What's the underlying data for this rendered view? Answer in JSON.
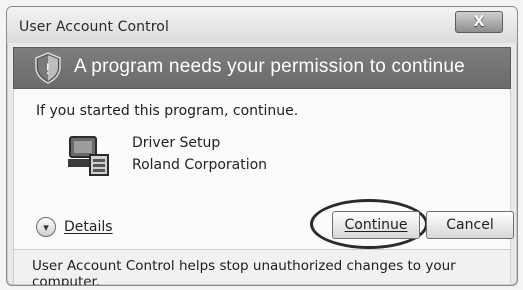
{
  "window": {
    "title": "User Account Control",
    "close_label": "X"
  },
  "banner": {
    "icon": "shield-icon",
    "text": "A program needs your permission to continue"
  },
  "content": {
    "intro": "If you started this program, continue.",
    "program": {
      "icon": "computer-setup-icon",
      "name": "Driver Setup",
      "publisher": "Roland Corporation"
    }
  },
  "actions": {
    "details_icon": "chevron-down-icon",
    "details_label": "Details",
    "continue_label": "Continue",
    "cancel_label": "Cancel"
  },
  "footer": {
    "text": "User Account Control helps stop unauthorized changes to your computer."
  }
}
